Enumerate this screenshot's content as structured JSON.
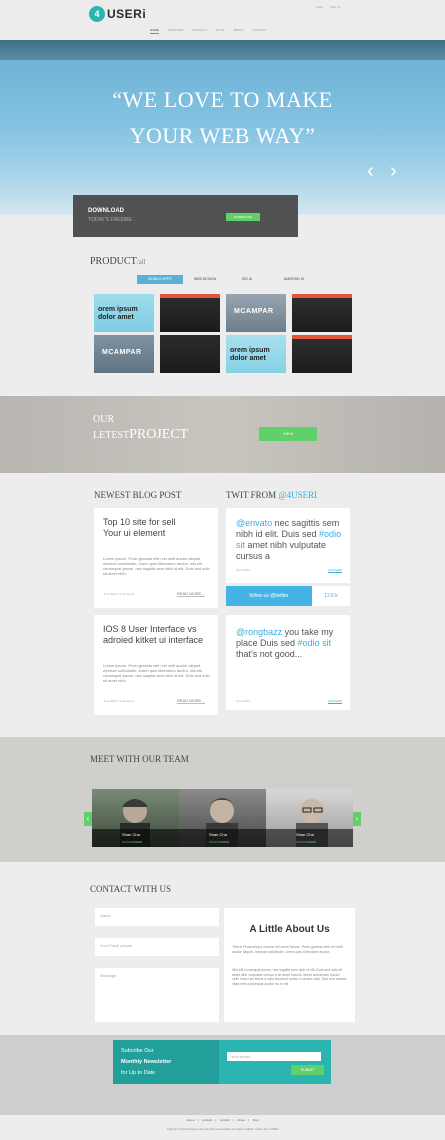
{
  "header": {
    "logo_badge": "4",
    "logo_text": "USERi",
    "top_links": [
      "Login",
      "Sign up"
    ],
    "nav": [
      "HOME",
      "FEATURES",
      "PRODUCT",
      "BLOG",
      "ABOUT",
      "CONTACT"
    ]
  },
  "hero": {
    "line1": "“WE LOVE TO MAKE",
    "line2": "YOUR WEB WAY”",
    "prev": "‹",
    "next": "›",
    "download_title": "DOWNLOAD",
    "download_sub": "TODAY'S FREEBIE",
    "download_btn": "DOWNLOAD"
  },
  "product": {
    "title": "PRODUCT",
    "title_suffix": "/all",
    "tabs": [
      "MOBILE APPS",
      "WEB DESIGN",
      "IOS UI",
      "ANDROID UI"
    ],
    "tile_text": "orem ipsum dolor amet",
    "tile_brand": "MCAMPAR"
  },
  "project": {
    "our": "OUR",
    "letest": "LETEST",
    "project": "PROJECT",
    "btn": "VIEW"
  },
  "blog": {
    "title": "NEWEST BLOG POST",
    "posts": [
      {
        "title": "Top 10 site for sell Your ui element",
        "body": "Lorem ipsum. Proin gravida nibh vel velit auctor aliquet. Aenean sollicitudin, lorem quis bibendum auctor, nisi elit consequat ipsum, nec sagittis sem nibh id elit. Duis sed odio sit amet nibh",
        "meta": "June 2013 / 5 comment",
        "more": "READ MORE..."
      },
      {
        "title": "IOS 8 User Interface vs adroied kitket ui interface",
        "body": "Lorem ipsum. Proin gravida nibh vel velit auctor aliquet. Aenean sollicitudin, lorem quis bibendum auctor, nisi elit consequat ipsum, nec sagittis sem nibh id elit. Duis sed odio sit amet nibh",
        "meta": "June 2013 / 5 comment",
        "more": "READ MORE..."
      }
    ]
  },
  "twitter": {
    "title": "TWIT FROM",
    "handle": "@4USERI",
    "tweet1": {
      "mention": "@envato",
      "t1": " nec sagittis sem nibh id elit. Duis sed ",
      "tag": "#odio sit",
      "t2": " amet nibh vulputate cursus a",
      "meta": "June 2013",
      "link": "@4USERI"
    },
    "follow": "follow us @twitter",
    "count": "12.6 k",
    "tweet2": {
      "mention": "@rongbazz",
      "t1": " you take my place Duis sed ",
      "tag": "#odio sit",
      "t2": " that's not good...",
      "meta": "June 2013",
      "link": "@4USERI"
    }
  },
  "team": {
    "title": "MEET WITH OUR TEAM",
    "members": [
      {
        "name": "Shan Cha",
        "role": "CO-FOUNDER"
      },
      {
        "name": "Shan Cha",
        "role": "CO-FOUNDER"
      },
      {
        "name": "Shan Cha",
        "role": "CO-FOUNDER"
      }
    ],
    "prev": "‹",
    "next": "›"
  },
  "contact": {
    "title": "CONTACT WITH US",
    "name_ph": "Name",
    "email_ph": "Your Email please",
    "message_ph": "Message",
    "about_title": "A Little About Us",
    "about_p1": "This is Photoshop's version of Lorem Ipsum. Proin gravida nibh vel velit auctor aliquet. Aenean sollicitudin, lorem quis bibendum auctor.",
    "about_p2": "Nisi elit consequat ipsum, nec sagittis sem nibh id elit. Duis sed odio sit amet nibh vulputate cursus a sit amet mauris. Morbi accumsan ipsum velit. Nam nec tellus a odio tincidunt auctor a ornare odio. Sed non mauris vitae erat consequat auctor eu in elit."
  },
  "newsletter": {
    "line1": "Subcribe Our",
    "line2": "Monthly Newsletter",
    "line3": "for Up to Date",
    "email_ph": "Your email",
    "btn": "SUBMIT"
  },
  "footer": {
    "links": [
      "Home",
      "product",
      "contact",
      "About",
      "blog"
    ],
    "copy": "Copyright © 2013 Company name All rights reserved More Templates 4USERi - Collect from 4USERi"
  },
  "colors": {
    "accent": "#2bb5b0",
    "green": "#5fd06a",
    "twitter": "#44b4e6"
  }
}
